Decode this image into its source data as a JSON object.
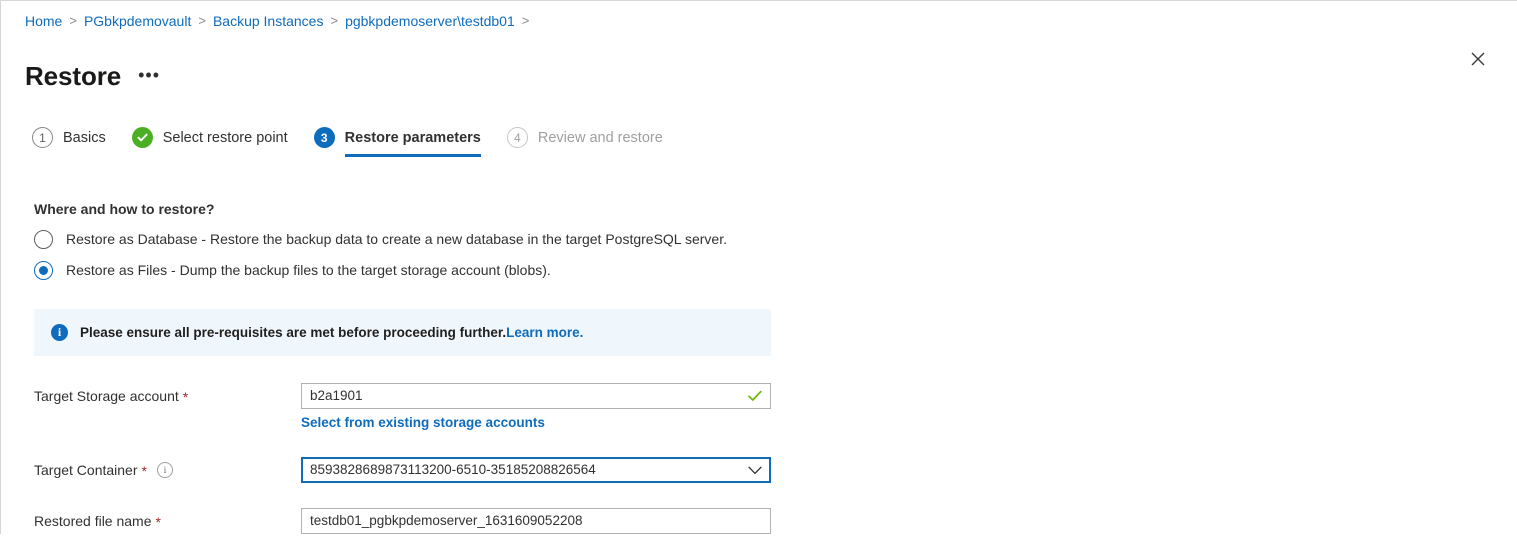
{
  "breadcrumb": {
    "separator": ">",
    "items": [
      {
        "label": "Home"
      },
      {
        "label": "PGbkpdemovault"
      },
      {
        "label": "Backup Instances"
      },
      {
        "label": "pgbkpdemoserver\\testdb01"
      }
    ]
  },
  "header": {
    "title": "Restore",
    "more_label": "•••",
    "close_label": "Close"
  },
  "wizard": {
    "steps": [
      {
        "number": "1",
        "label": "Basics",
        "state": "pending"
      },
      {
        "number": "2",
        "label": "Select restore point",
        "state": "completed"
      },
      {
        "number": "3",
        "label": "Restore parameters",
        "state": "active"
      },
      {
        "number": "4",
        "label": "Review and restore",
        "state": "disabled"
      }
    ]
  },
  "main": {
    "section_title": "Where and how to restore?",
    "restore_options": [
      {
        "label": "Restore as Database - Restore the backup data to create a new database in the target PostgreSQL server.",
        "selected": false
      },
      {
        "label": "Restore as Files - Dump the backup files to the target storage account (blobs).",
        "selected": true
      }
    ],
    "info_banner": {
      "icon": "info-icon",
      "text": "Please ensure all pre-requisites are met before proceeding further.",
      "link_text": "Learn more."
    },
    "fields": {
      "storage_account": {
        "label": "Target Storage account",
        "required_mark": "*",
        "value": "b2a1901",
        "validation": "valid",
        "sublink": "Select from existing storage accounts"
      },
      "target_container": {
        "label": "Target Container",
        "required_mark": "*",
        "value": "8593828689873113200-6510-35185208826564",
        "has_info_icon": true,
        "info_glyph": "i",
        "focused": true
      },
      "restored_file_name": {
        "label": "Restored file name",
        "required_mark": "*",
        "value": "testdb01_pgbkpdemoserver_1631609052208"
      }
    }
  },
  "colors": {
    "link_blue": "#0f6cbd",
    "success_green": "#4caf23",
    "required_red": "#a4262c",
    "banner_bg": "#eff6fc"
  }
}
